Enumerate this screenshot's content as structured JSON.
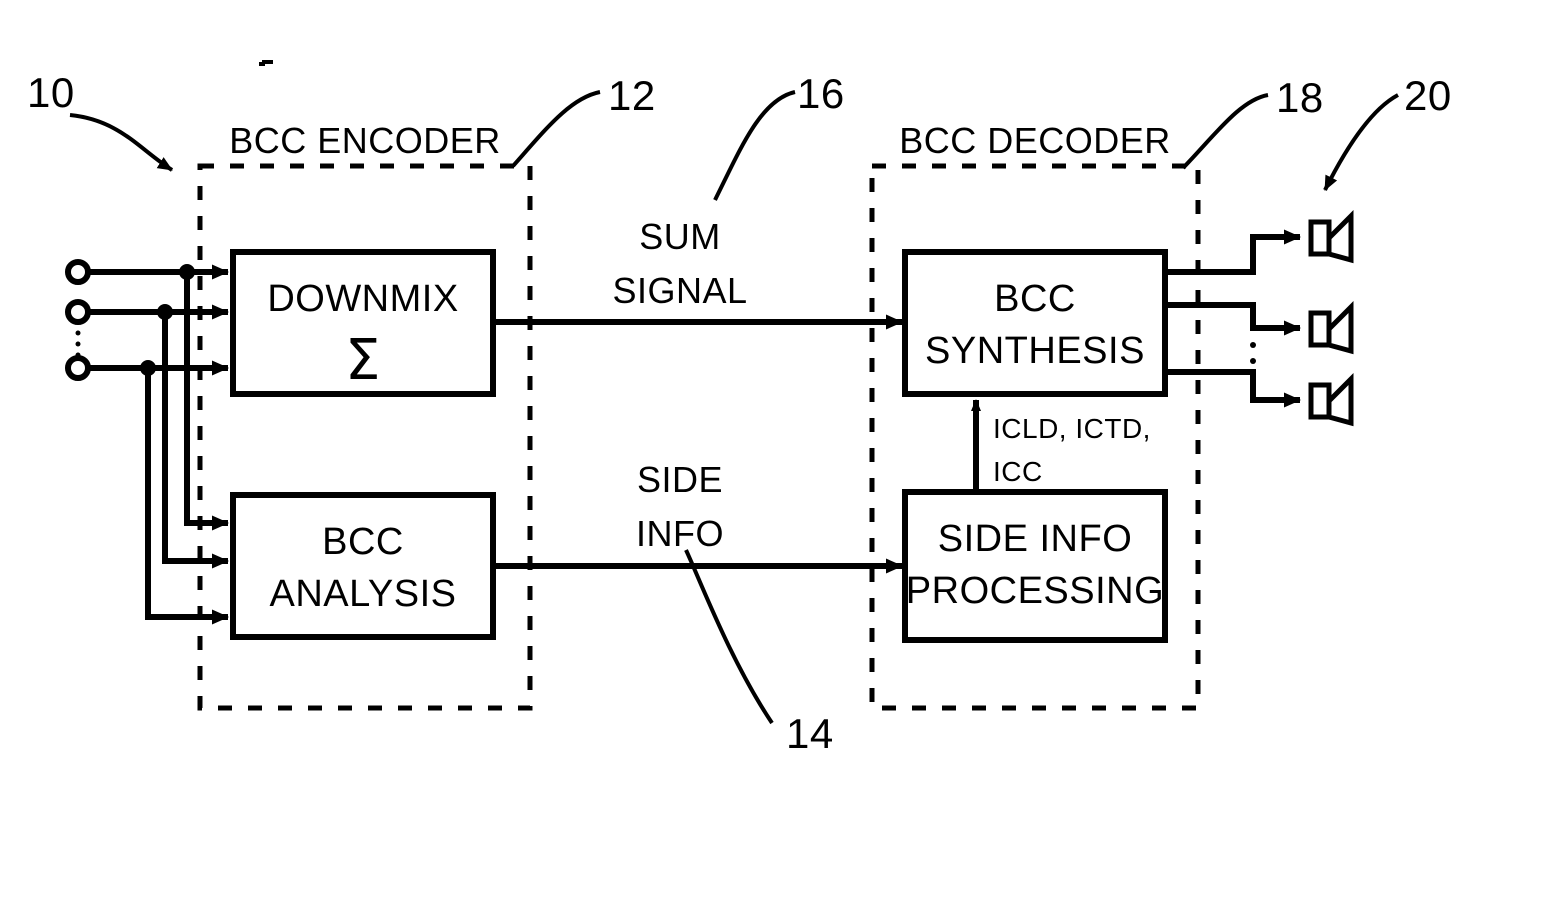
{
  "figure": {
    "title_regions": {
      "encoder_label": "BCC ENCODER",
      "decoder_label": "BCC DECODER"
    },
    "blocks": [
      {
        "id": "downmix",
        "line1": "DOWNMIX",
        "line2": "Σ"
      },
      {
        "id": "analysis",
        "line1": "BCC",
        "line2": "ANALYSIS"
      },
      {
        "id": "synthesis",
        "line1": "BCC",
        "line2": "SYNTHESIS"
      },
      {
        "id": "sideinfo",
        "line1": "SIDE INFO",
        "line2": "PROCESSING"
      }
    ],
    "signals": {
      "sum_signal_line1": "SUM",
      "sum_signal_line2": "SIGNAL",
      "side_info_line1": "SIDE",
      "side_info_line2": "INFO",
      "params_line1": "ICLD, ICTD,",
      "params_line2": "ICC"
    },
    "reference_numerals": {
      "system": "10",
      "encoder": "12",
      "side_info": "14",
      "sum_signal": "16",
      "decoder": "18",
      "loudspeakers": "20"
    },
    "colors": {
      "ink": "#000000",
      "paper": "#ffffff"
    },
    "counts": {
      "input_channels": 3,
      "output_speakers": 3
    }
  }
}
